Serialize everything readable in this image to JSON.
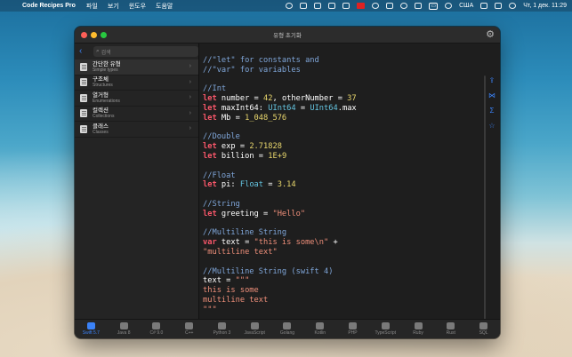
{
  "menubar": {
    "apple": "",
    "app_name": "Code Recipes Pro",
    "menus": [
      "파일",
      "보기",
      "윈도우",
      "도움말"
    ],
    "input_source": "США",
    "clock": "Чт, 1 дек.  11:29"
  },
  "window": {
    "title": "유형 초기화"
  },
  "sidebar": {
    "search_placeholder": "검색",
    "items": [
      {
        "title": "간단한 유형",
        "subtitle": "Simple types"
      },
      {
        "title": "구조체",
        "subtitle": "Structures"
      },
      {
        "title": "열거형",
        "subtitle": "Enumerations"
      },
      {
        "title": "컬렉션",
        "subtitle": "Collections"
      },
      {
        "title": "클래스",
        "subtitle": "Classes"
      }
    ]
  },
  "code_lines": [
    [
      [
        "com",
        "//\"let\" for constants and"
      ]
    ],
    [
      [
        "com",
        "//\"var\" for variables"
      ]
    ],
    [],
    [
      [
        "com",
        "//Int"
      ]
    ],
    [
      [
        "kw",
        "let"
      ],
      [
        "op",
        " number = "
      ],
      [
        "num",
        "42"
      ],
      [
        "op",
        ", otherNumber = "
      ],
      [
        "num",
        "37"
      ]
    ],
    [
      [
        "kw",
        "let"
      ],
      [
        "op",
        " maxInt64: "
      ],
      [
        "type",
        "UInt64"
      ],
      [
        "op",
        " = "
      ],
      [
        "type",
        "UInt64"
      ],
      [
        "op",
        ".max"
      ]
    ],
    [
      [
        "kw",
        "let"
      ],
      [
        "op",
        " Mb = "
      ],
      [
        "num",
        "1_048_576"
      ]
    ],
    [],
    [
      [
        "com",
        "//Double"
      ]
    ],
    [
      [
        "kw",
        "let"
      ],
      [
        "op",
        " exp = "
      ],
      [
        "num",
        "2.71828"
      ]
    ],
    [
      [
        "kw",
        "let"
      ],
      [
        "op",
        " billion = "
      ],
      [
        "num",
        "1E+9"
      ]
    ],
    [],
    [
      [
        "com",
        "//Float"
      ]
    ],
    [
      [
        "kw",
        "let"
      ],
      [
        "op",
        " pi: "
      ],
      [
        "type",
        "Float"
      ],
      [
        "op",
        " = "
      ],
      [
        "num",
        "3.14"
      ]
    ],
    [],
    [
      [
        "com",
        "//String"
      ]
    ],
    [
      [
        "kw",
        "let"
      ],
      [
        "op",
        " greeting = "
      ],
      [
        "str",
        "\"Hello\""
      ]
    ],
    [],
    [
      [
        "com",
        "//Multiline String"
      ]
    ],
    [
      [
        "kw",
        "var"
      ],
      [
        "op",
        " text = "
      ],
      [
        "str",
        "\"this is some\\n\""
      ],
      [
        "op",
        " +"
      ]
    ],
    [
      [
        "str",
        "\"multiline text\""
      ]
    ],
    [],
    [
      [
        "com",
        "//Multiline String (swift 4)"
      ]
    ],
    [
      [
        "op",
        "text = "
      ],
      [
        "str",
        "\"\"\""
      ]
    ],
    [
      [
        "str",
        "this is some"
      ]
    ],
    [
      [
        "str",
        "multiline text"
      ]
    ],
    [
      [
        "str",
        "\"\"\""
      ]
    ]
  ],
  "right_tools": [
    "share-icon",
    "compare-icon",
    "sigma-icon",
    "star-icon"
  ],
  "languages": [
    {
      "label": "Swift 5.7",
      "icon": "swift-icon",
      "active": true
    },
    {
      "label": "Java 8",
      "icon": "java-icon",
      "active": false
    },
    {
      "label": "C# 9.0",
      "icon": "csharp-icon",
      "active": false
    },
    {
      "label": "C++",
      "icon": "cpp-icon",
      "active": false
    },
    {
      "label": "Python 3",
      "icon": "python-icon",
      "active": false
    },
    {
      "label": "JavaScript",
      "icon": "javascript-icon",
      "active": false
    },
    {
      "label": "Golang",
      "icon": "golang-icon",
      "active": false
    },
    {
      "label": "Kotlin",
      "icon": "kotlin-icon",
      "active": false
    },
    {
      "label": "PHP",
      "icon": "php-icon",
      "active": false
    },
    {
      "label": "TypeScript",
      "icon": "typescript-icon",
      "active": false
    },
    {
      "label": "Ruby",
      "icon": "ruby-icon",
      "active": false
    },
    {
      "label": "Rust",
      "icon": "rust-icon",
      "active": false
    },
    {
      "label": "SQL",
      "icon": "sql-icon",
      "active": false
    }
  ],
  "colors": {
    "accent": "#3b82f6",
    "keyword": "#f9576a",
    "comment": "#7fa6d9",
    "number": "#e9d76d",
    "type": "#64c4e0",
    "string": "#ef8f7a"
  }
}
